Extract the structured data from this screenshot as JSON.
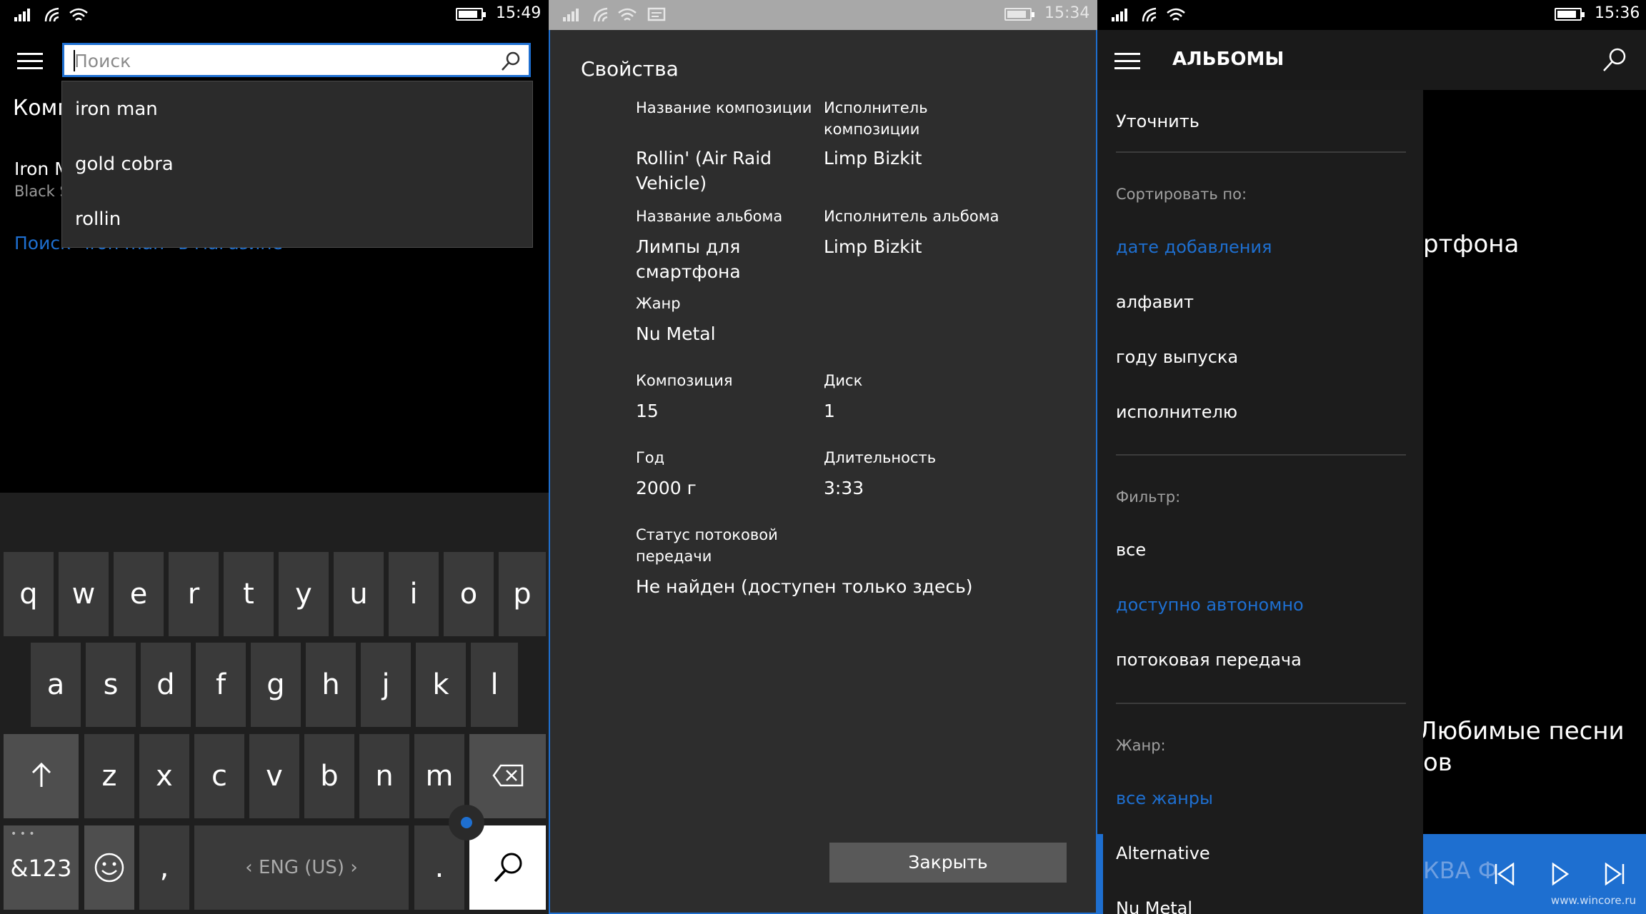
{
  "colors": {
    "accent": "#1e6fd0"
  },
  "panel1": {
    "time": "15:49",
    "search": {
      "placeholder": "Поиск",
      "icon": "search-icon"
    },
    "suggestions": [
      "iron man",
      "gold cobra",
      "rollin"
    ],
    "background": {
      "heading_partial": "Комп",
      "item_title_partial": "Iron M",
      "item_subtitle_partial": "Black S",
      "store_link_partial": "Поиск \"iron man\" в магазине"
    },
    "keyboard": {
      "row1": [
        "q",
        "w",
        "e",
        "r",
        "t",
        "y",
        "u",
        "i",
        "o",
        "p"
      ],
      "row2": [
        "a",
        "s",
        "d",
        "f",
        "g",
        "h",
        "j",
        "k",
        "l"
      ],
      "row3": [
        "z",
        "x",
        "c",
        "v",
        "b",
        "n",
        "m"
      ],
      "symbols_label": "&123",
      "symbols_dots": "• • •",
      "comma": ",",
      "space_label": "‹ ENG (US) ›",
      "period": "."
    }
  },
  "panel2": {
    "time": "15:34",
    "title": "Свойства",
    "fields": {
      "track_name_label": "Название композиции",
      "track_name_value": "Rollin' (Air Raid Vehicle)",
      "track_artist_label": "Исполнитель композиции",
      "track_artist_value": "Limp Bizkit",
      "album_name_label": "Название альбома",
      "album_name_value": "Лимпы для смартфона",
      "album_artist_label": "Исполнитель альбома",
      "album_artist_value": "Limp Bizkit",
      "genre_label": "Жанр",
      "genre_value": "Nu Metal",
      "track_no_label": "Композиция",
      "track_no_value": "15",
      "disc_label": "Диск",
      "disc_value": "1",
      "year_label": "Год",
      "year_value": "2000 г",
      "duration_label": "Длительность",
      "duration_value": "3:33",
      "stream_label": "Статус потоковой передачи",
      "stream_value": "Не найден (доступен только здесь)"
    },
    "close_label": "Закрыть"
  },
  "panel3": {
    "time": "15:36",
    "title": "АЛЬБОМЫ",
    "refine": "Уточнить",
    "sort_label": "Сортировать по:",
    "sort_options": [
      "дате добавления",
      "алфавит",
      "году выпуска",
      "исполнителю"
    ],
    "filter_label": "Фильтр:",
    "filter_options": [
      "все",
      "доступно автономно",
      "потоковая передача"
    ],
    "genre_label": "Жанр:",
    "genre_options": [
      "все жанры",
      "Alternative",
      "Nu Metal"
    ],
    "background": {
      "text1_partial": "ртфона",
      "text2_partial": "Любимые песни",
      "text3_partial": "ов",
      "player_text_partial": "КВА Ф"
    },
    "watermark": "www.wincore.ru"
  }
}
